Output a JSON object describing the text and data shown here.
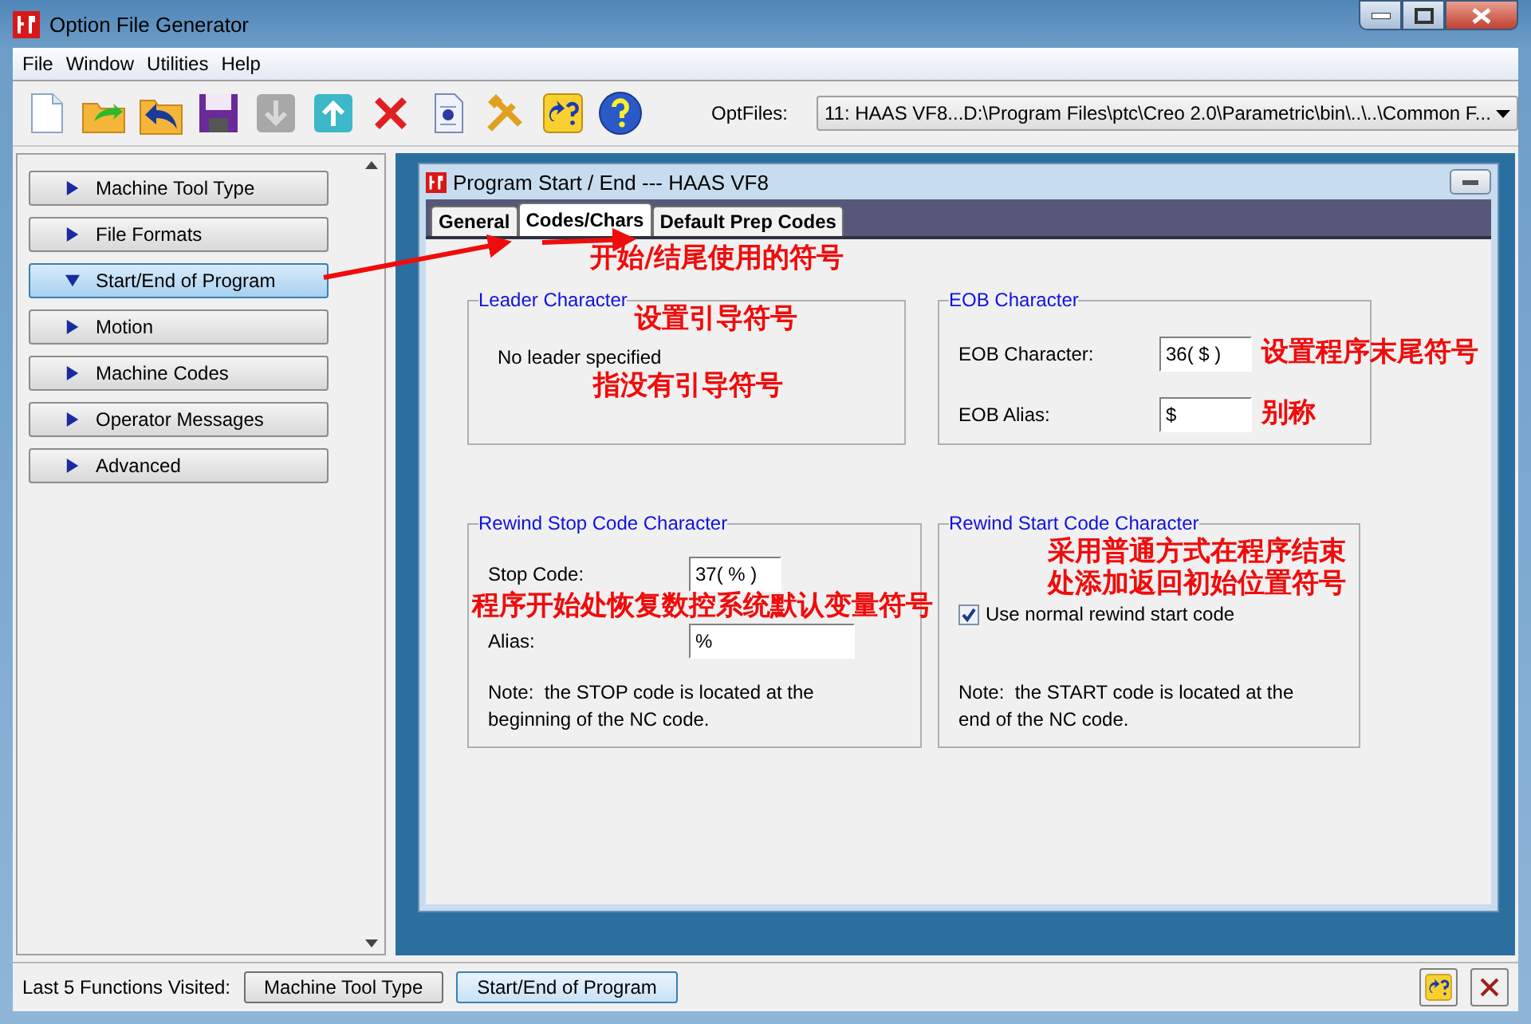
{
  "window": {
    "title": "Option File Generator"
  },
  "menu": [
    "File",
    "Window",
    "Utilities",
    "Help"
  ],
  "toolbar": {
    "optfiles_label": "OptFiles:",
    "optfiles_value": "11:  HAAS VF8...D:\\Program Files\\ptc\\Creo 2.0\\Parametric\\bin\\..\\..\\Common F..."
  },
  "sidebar": {
    "items": [
      {
        "label": "Machine Tool Type",
        "selected": false,
        "expanded": false
      },
      {
        "label": "File Formats",
        "selected": false,
        "expanded": false
      },
      {
        "label": "Start/End of Program",
        "selected": true,
        "expanded": true
      },
      {
        "label": "Motion",
        "selected": false,
        "expanded": false
      },
      {
        "label": "Machine Codes",
        "selected": false,
        "expanded": false
      },
      {
        "label": "Operator Messages",
        "selected": false,
        "expanded": false
      },
      {
        "label": "Advanced",
        "selected": false,
        "expanded": false
      }
    ]
  },
  "inner_window": {
    "title": "Program Start / End --- HAAS VF8",
    "tabs": [
      {
        "label": "General",
        "selected": false
      },
      {
        "label": "Codes/Chars",
        "selected": true
      },
      {
        "label": "Default Prep Codes",
        "selected": false
      }
    ],
    "tab_annotation": "开始/结尾使用的符号",
    "leader": {
      "title": "Leader Character",
      "title_annotation": "设置引导符号",
      "text": "No leader specified",
      "annotation": "指没有引导符号"
    },
    "eob": {
      "title": "EOB Character",
      "fields": [
        {
          "label": "EOB Character:",
          "value": "36( $ )",
          "annotation": "设置程序末尾符号"
        },
        {
          "label": "EOB Alias:",
          "value": "$",
          "annotation": "别称"
        }
      ]
    },
    "rewind_stop": {
      "title": "Rewind Stop Code Character",
      "fields": [
        {
          "label": "Stop Code:",
          "value": "37( % )"
        },
        {
          "label": "Alias:",
          "value": "%"
        }
      ],
      "annotation": "程序开始处恢复数控系统默认变量符号",
      "note": "Note:  the STOP code is located at the beginning of the NC code."
    },
    "rewind_start": {
      "title": "Rewind Start Code Character",
      "annotation_lines": [
        "采用普通方式在程序结束",
        "处添加返回初始位置符号"
      ],
      "checkbox": {
        "label": "Use normal rewind start code",
        "checked": true
      },
      "note": "Note:  the START code is located at the end of the NC code."
    }
  },
  "footer": {
    "label": "Last 5 Functions Visited:",
    "buttons": [
      "Machine Tool Type",
      "Start/End of Program"
    ]
  }
}
